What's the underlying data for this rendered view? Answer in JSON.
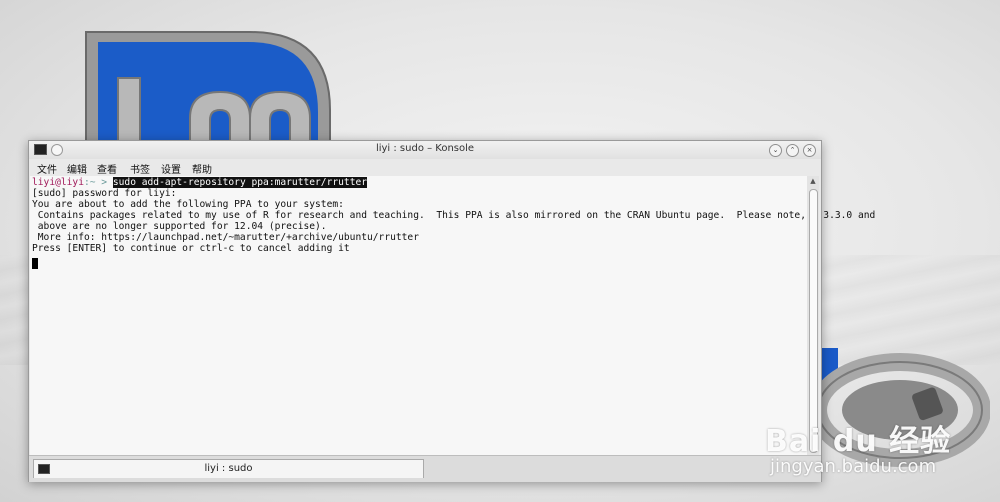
{
  "window": {
    "title": "liyi : sudo – Konsole",
    "icons": [
      "terminal-app-icon",
      "pin-icon",
      "minimize-icon",
      "maximize-icon",
      "close-icon"
    ]
  },
  "menu": [
    "文件",
    "编辑",
    "查看",
    "书签",
    "设置",
    "帮助"
  ],
  "terminal": {
    "prompt_user": "liyi@liyi",
    "prompt_sep": ":~ > ",
    "command": "sudo add-apt-repository ppa:marutter/rrutter",
    "lines": [
      "[sudo] password for liyi:",
      "You are about to add the following PPA to your system:",
      " Contains packages related to my use of R for research and teaching.  This PPA is also mirrored on the CRAN Ubuntu page.  Please note, R 3.3.0 and",
      " above are no longer supported for 12.04 (precise).",
      " More info: https://launchpad.net/~marutter/+archive/ubuntu/rrutter",
      "Press [ENTER] to continue or ctrl-c to cancel adding it"
    ]
  },
  "tabs": [
    {
      "label": "liyi : sudo"
    }
  ],
  "watermark": {
    "brand": "Bai du 经验",
    "url": "jingyan.baidu.com"
  },
  "colors": {
    "terminal_bg": "#f7f7f7",
    "prompt_user": "#a01a5a",
    "wallpaper_logo_blue": "#1a5ac8"
  }
}
